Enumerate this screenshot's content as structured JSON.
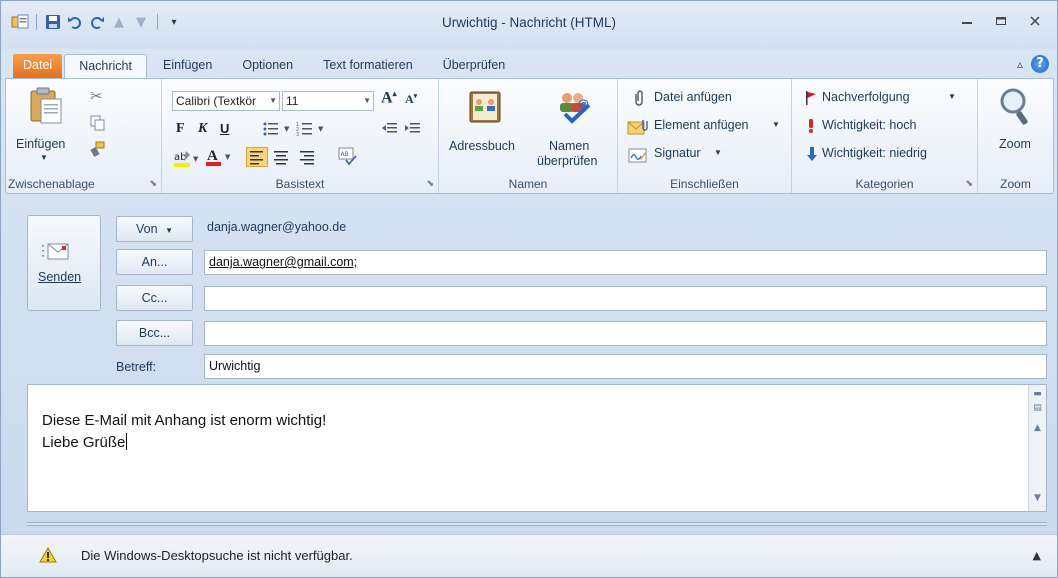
{
  "window": {
    "title": "Urwichtig - Nachricht (HTML)"
  },
  "tabs": [
    {
      "label": "Datei"
    },
    {
      "label": "Nachricht"
    },
    {
      "label": "Einfügen"
    },
    {
      "label": "Optionen"
    },
    {
      "label": "Text formatieren"
    },
    {
      "label": "Überprüfen"
    }
  ],
  "ribbon": {
    "clipboard": {
      "group_label": "Zwischenablage",
      "paste_label": "Einfügen"
    },
    "basictext": {
      "group_label": "Basistext",
      "font_name": "Calibri (Textkör",
      "font_size": "11",
      "bold": "F",
      "italic": "K",
      "underline": "U"
    },
    "names": {
      "group_label": "Namen",
      "addressbook_label": "Adressbuch",
      "check_names_line1": "Namen",
      "check_names_line2": "überprüfen"
    },
    "include": {
      "group_label": "Einschließen",
      "attach_file": "Datei anfügen",
      "attach_item": "Element anfügen",
      "signature": "Signatur"
    },
    "tags": {
      "group_label": "Kategorien",
      "followup": "Nachverfolgung",
      "high_importance": "Wichtigkeit: hoch",
      "low_importance": "Wichtigkeit: niedrig"
    },
    "zoom": {
      "group_label": "Zoom",
      "zoom_label": "Zoom"
    }
  },
  "message": {
    "send_label": "Senden",
    "from_button": "Von",
    "from_value": "danja.wagner@yahoo.de",
    "to_button": "An...",
    "to_value": "danja.wagner@gmail.com;",
    "cc_button": "Cc...",
    "cc_value": "",
    "bcc_button": "Bcc...",
    "bcc_value": "",
    "subject_label": "Betreff:",
    "subject_value": "Urwichtig",
    "body_line1": "Diese E-Mail  mit Anhang ist enorm wichtig!",
    "body_line2": "Liebe Grüße"
  },
  "statusbar": {
    "text": "Die Windows-Desktopsuche ist nicht verfügbar."
  },
  "colors": {
    "file_tab": "#e4701c",
    "accent": "#1e395b",
    "high_importance": "#d42a1f",
    "low_importance": "#2a63c8"
  }
}
